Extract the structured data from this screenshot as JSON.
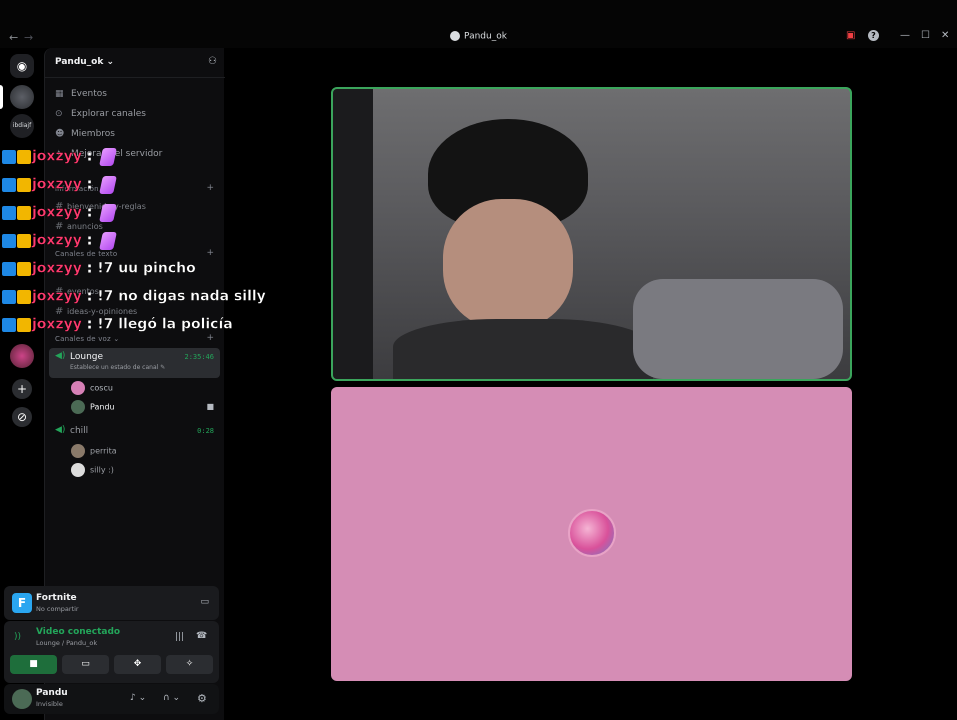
{
  "titlebar": {
    "back": "←",
    "forward": "→",
    "title": "Pandu_ok",
    "inbox_icon": "inbox-icon",
    "help": "?",
    "minimize": "—",
    "maximize": "☐",
    "close": "✕"
  },
  "rail": {
    "discord_icon": "discord-icon",
    "server_label": "ibdiajf",
    "add_icon": "+",
    "discover_icon": "compass-icon"
  },
  "server": {
    "name": "Pandu_ok",
    "chevron": "⌄"
  },
  "nav": [
    {
      "icon": "▦",
      "label": "Eventos"
    },
    {
      "icon": "⊙",
      "label": "Explorar canales"
    },
    {
      "icon": "☻",
      "label": "Miembros"
    },
    {
      "icon": "✦",
      "label": "Mejoras del servidor"
    }
  ],
  "categories": {
    "info": "información",
    "text": "Canales de texto",
    "voice": "Canales de voz"
  },
  "channels": {
    "info": [
      "bienvenida-y-reglas",
      "anuncios"
    ],
    "text": [
      "eventos",
      "ideas-y-opiniones"
    ]
  },
  "voice": {
    "lounge": {
      "name": "Lounge",
      "time": "2:35:46",
      "status": "Establece un estado de canal",
      "users": [
        "coscu",
        "Pandu"
      ]
    },
    "chill": {
      "name": "chill",
      "time": "0:28",
      "users": [
        "perrita",
        "silly :)"
      ]
    }
  },
  "activity": {
    "game": "Fortnite",
    "sub": "No compartir"
  },
  "connection": {
    "status": "Video conectado",
    "location": "Lounge / Pandu_ok",
    "buttons": [
      "video-icon",
      "screen-share-icon",
      "activity-icon",
      "soundboard-icon"
    ]
  },
  "user": {
    "name": "Pandu",
    "status": "Invisible"
  },
  "chat": [
    {
      "nick": "joxzyy",
      "text": "",
      "emote": true
    },
    {
      "nick": "joxzyy",
      "text": "",
      "emote": true
    },
    {
      "nick": "joxzyy",
      "text": "",
      "emote": true
    },
    {
      "nick": "joxzyy",
      "text": "",
      "emote": true
    },
    {
      "nick": "joxzyy",
      "text": "!7 uu pincho",
      "emote": false
    },
    {
      "nick": "joxzyy",
      "text": "!7 no digas nada silly",
      "emote": false
    },
    {
      "nick": "joxzyy",
      "text": "!7 llegó la policía",
      "emote": false
    }
  ],
  "colors": {
    "accent_green": "#23a55a",
    "tile_border": "#3ba55c",
    "tile2_bg": "#d58db5",
    "nick": "#ff3a6e"
  }
}
